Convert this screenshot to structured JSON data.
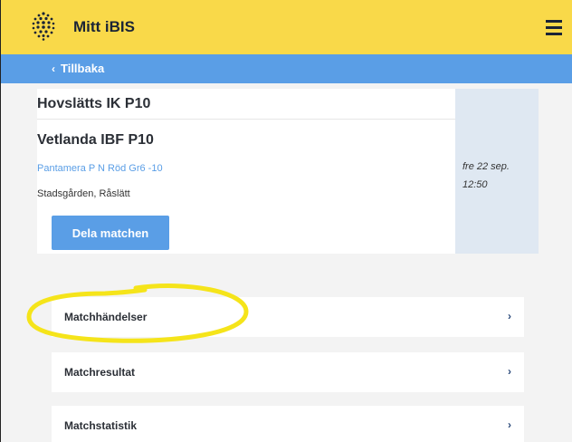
{
  "header": {
    "app_title": "Mitt iBIS",
    "logo_icon": "ibis-dot-logo-icon",
    "menu_icon": "hamburger-menu-icon"
  },
  "nav": {
    "back_label": "Tillbaka",
    "back_icon": "chevron-left-icon"
  },
  "match": {
    "home_team": "Hovslätts IK P10",
    "away_team": "Vetlanda IBF P10",
    "series": "Pantamera P N Röd Gr6 -10",
    "venue": "Stadsgården, Råslätt",
    "date": "fre 22 sep.",
    "time": "12:50",
    "share_label": "Dela matchen"
  },
  "menu": {
    "items": [
      {
        "label": "Matchhändelser"
      },
      {
        "label": "Matchresultat"
      },
      {
        "label": "Matchstatistik"
      }
    ],
    "chevron_icon": "chevron-right-icon"
  },
  "colors": {
    "header_bg": "#f9d949",
    "accent_blue": "#5a9ee6",
    "highlight": "#f5e41a"
  }
}
